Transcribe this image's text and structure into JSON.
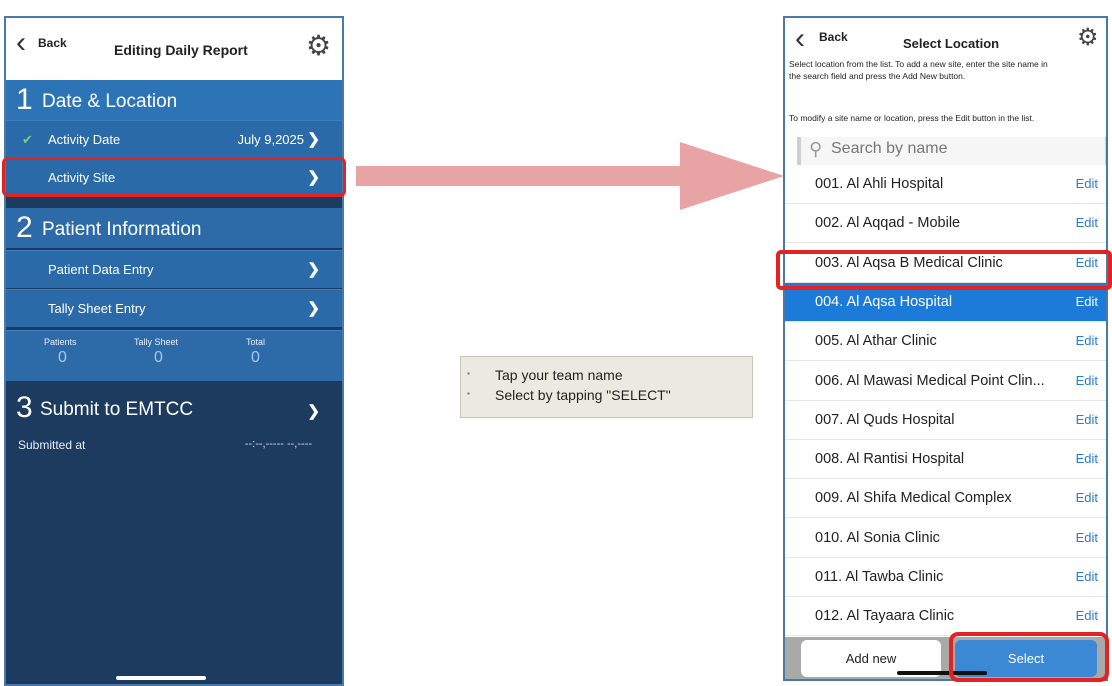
{
  "left_screen": {
    "nav": {
      "back_label": "Back",
      "title": "Editing Daily Report",
      "settings_icon": "gear-icon"
    },
    "section1": {
      "number": "1",
      "title": "Date & Location"
    },
    "activity_date": {
      "label": "Activity Date",
      "value": "July 9,2025",
      "status_icon": "check-icon"
    },
    "activity_site": {
      "label": "Activity Site"
    },
    "section2": {
      "number": "2",
      "title": "Patient Information"
    },
    "patient_data_entry": {
      "label": "Patient Data Entry"
    },
    "tally_sheet_entry": {
      "label": "Tally Sheet Entry"
    },
    "counts": {
      "patients_label": "Patients",
      "patients_value": "0",
      "tally_label": "Tally Sheet",
      "tally_value": "0",
      "total_label": "Total",
      "total_value": "0"
    },
    "section3": {
      "number": "3",
      "title": "Submit to EMTCC"
    },
    "submitted": {
      "label": "Submitted at",
      "value": "--:--,----- --,----"
    }
  },
  "tooltip": {
    "line1": "Tap your team name",
    "line2": "Select by tapping \"SELECT\""
  },
  "right_screen": {
    "nav": {
      "back_label": "Back",
      "title": "Select Location",
      "settings_icon": "gear-icon"
    },
    "instructions": {
      "line1": "Select location from the list. To add a new site, enter the site name in",
      "line2": "the search field and press the Add New button.",
      "line3": "To modify a site name or location, press the Edit button in the list."
    },
    "search": {
      "placeholder": "Search by name",
      "icon": "search-icon"
    },
    "locations": [
      {
        "name": "001.  Al Ahli Hospital",
        "edit": "Edit"
      },
      {
        "name": "002.  Al Aqqad - Mobile",
        "edit": "Edit"
      },
      {
        "name": "003.  Al Aqsa B Medical Clinic",
        "edit": "Edit"
      },
      {
        "name": "004.  Al Aqsa Hospital",
        "edit": "Edit",
        "selected": true
      },
      {
        "name": "005.  Al Athar Clinic",
        "edit": "Edit"
      },
      {
        "name": "006.  Al Mawasi Medical Point Clin...",
        "edit": "Edit"
      },
      {
        "name": "007.  Al Quds Hospital",
        "edit": "Edit"
      },
      {
        "name": "008.  Al Rantisi Hospital",
        "edit": "Edit"
      },
      {
        "name": "009.  Al Shifa Medical Complex",
        "edit": "Edit"
      },
      {
        "name": "010.  Al Sonia Clinic",
        "edit": "Edit"
      },
      {
        "name": "011.  Al Tawba Clinic",
        "edit": "Edit"
      },
      {
        "name": "012.  Al Tayaara Clinic",
        "edit": "Edit"
      }
    ],
    "buttons": {
      "add_new": "Add new",
      "select": "Select"
    }
  },
  "colors": {
    "section_blue": "#2d74b7",
    "dark_navy": "#1d3a5f",
    "selected_row": "#1c7ad8",
    "edit_link": "#2a7bd3",
    "highlight_red": "#e52222",
    "arrow_pink": "#e8a3a5"
  }
}
